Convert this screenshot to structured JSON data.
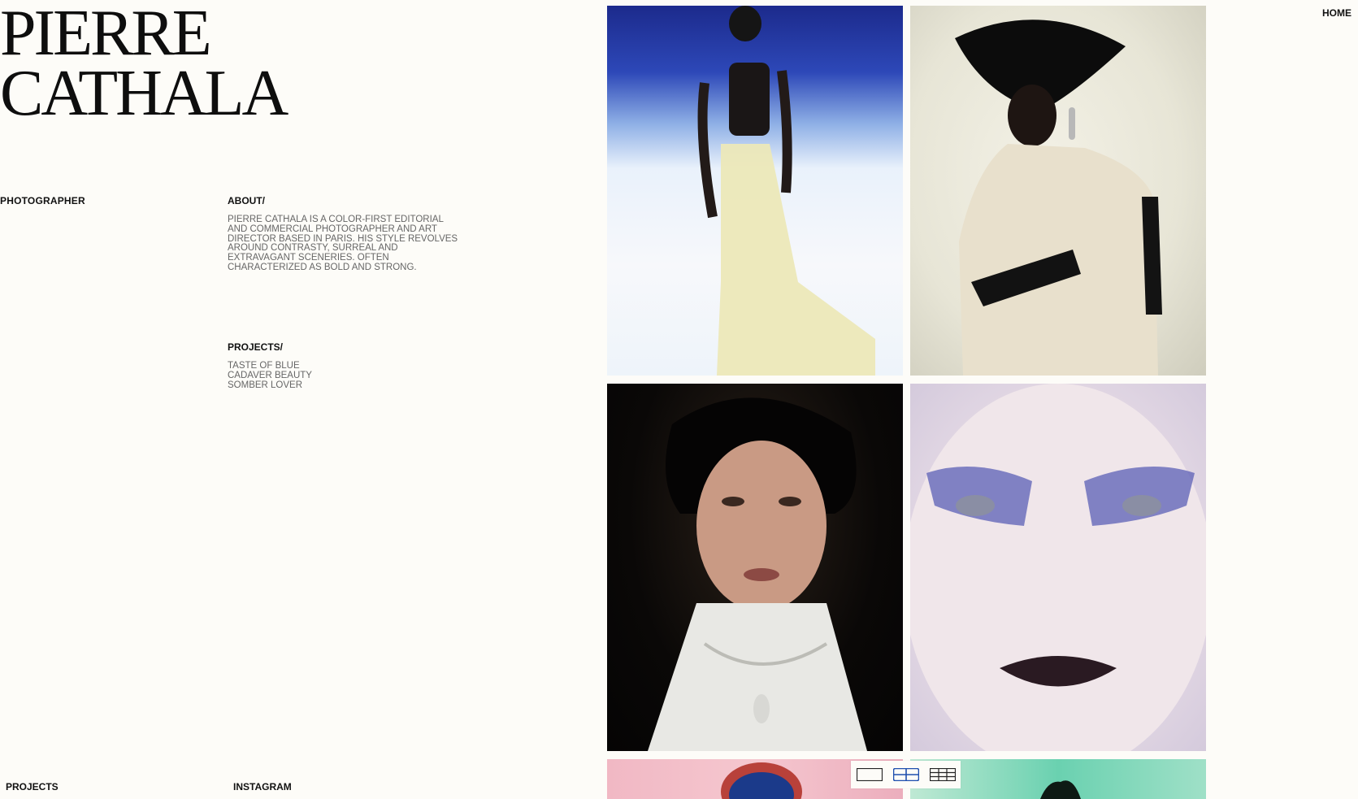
{
  "site": {
    "name_line1": "PIERRE",
    "name_line2": "CATHALA",
    "role": "PHOTOGRAPHER"
  },
  "nav": {
    "home": "HOME"
  },
  "about": {
    "title": "ABOUT/",
    "text": "PIERRE CATHALA IS A COLOR-FIRST EDITORIAL AND COMMERCIAL PHOTOGRAPHER AND ART DIRECTOR BASED IN PARIS. HIS STYLE REVOLVES AROUND CONTRASTY, SURREAL AND EXTRAVAGANT SCENERIES. OFTEN CHARACTERIZED AS BOLD AND STRONG."
  },
  "projects": {
    "title": "PROJECTS/",
    "items": [
      "TASTE OF BLUE",
      "CADAVER BEAUTY",
      "SOMBER LOVER"
    ]
  },
  "footer": {
    "projects": "PROJECTS",
    "instagram": "INSTAGRAM"
  },
  "view_switch": {
    "active": "grid-2",
    "accent": "#1f4fae",
    "icons": [
      "single-view-icon",
      "grid-2-icon",
      "grid-3-icon"
    ]
  }
}
